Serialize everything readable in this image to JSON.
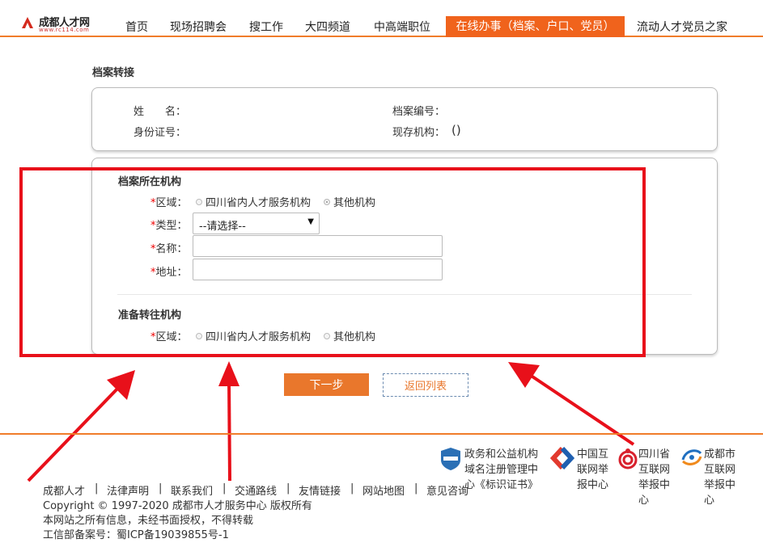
{
  "nav": {
    "logo_text": "成都人才网",
    "logo_sub": "www.rc114.com",
    "items": [
      "首页",
      "现场招聘会",
      "搜工作",
      "大四频道",
      "中高端职位"
    ],
    "active": "在线办事（档案、户口、党员）",
    "last": "流动人才党员之家"
  },
  "section_title": "档案转接",
  "info": {
    "name_label": "姓　　名：",
    "id_label": "身份证号：",
    "archive_no_label": "档案编号：",
    "current_org_label": "现存机构：",
    "current_org_value": "()"
  },
  "from": {
    "title": "档案所在机构",
    "region_label": "区域：",
    "region_opt1": "四川省内人才服务机构",
    "region_opt2": "其他机构",
    "region_selected": "其他机构",
    "type_label": "类型：",
    "type_value": "--请选择--",
    "name_label": "名称：",
    "address_label": "地址："
  },
  "to": {
    "title": "准备转往机构",
    "region_label": "区域：",
    "region_opt1": "四川省内人才服务机构",
    "region_opt2": "其他机构"
  },
  "required_mark": "*",
  "buttons": {
    "next": "下一步",
    "back": "返回列表"
  },
  "footer": {
    "links": [
      "成都人才",
      "法律声明",
      "联系我们",
      "交通路线",
      "友情链接",
      "网站地图",
      "意见咨询"
    ],
    "separator": "|",
    "copyright": "Copyright © 1997-2020 成都市人才服务中心 版权所有",
    "notice": "本网站之所有信息，未经书面授权，不得转载",
    "icp": "工信部备案号：蜀ICP备19039855号-1",
    "badges": [
      {
        "icon": "government-badge-icon",
        "lines": [
          "政务和公益机构",
          "域名注册管理中",
          "心《标识证书》"
        ]
      },
      {
        "icon": "china-report-icon",
        "lines": [
          "中国互",
          "联网举",
          "报中心"
        ]
      },
      {
        "icon": "sichuan-report-icon",
        "lines": [
          "四川省",
          "互联网",
          "举报中",
          "心"
        ]
      },
      {
        "icon": "chengdu-report-icon",
        "lines": [
          "成都市",
          "互联网",
          "举报中",
          "心"
        ]
      }
    ]
  },
  "colors": {
    "accent": "#f0631c",
    "button": "#e9772c",
    "annotation_red": "#e8101a"
  }
}
